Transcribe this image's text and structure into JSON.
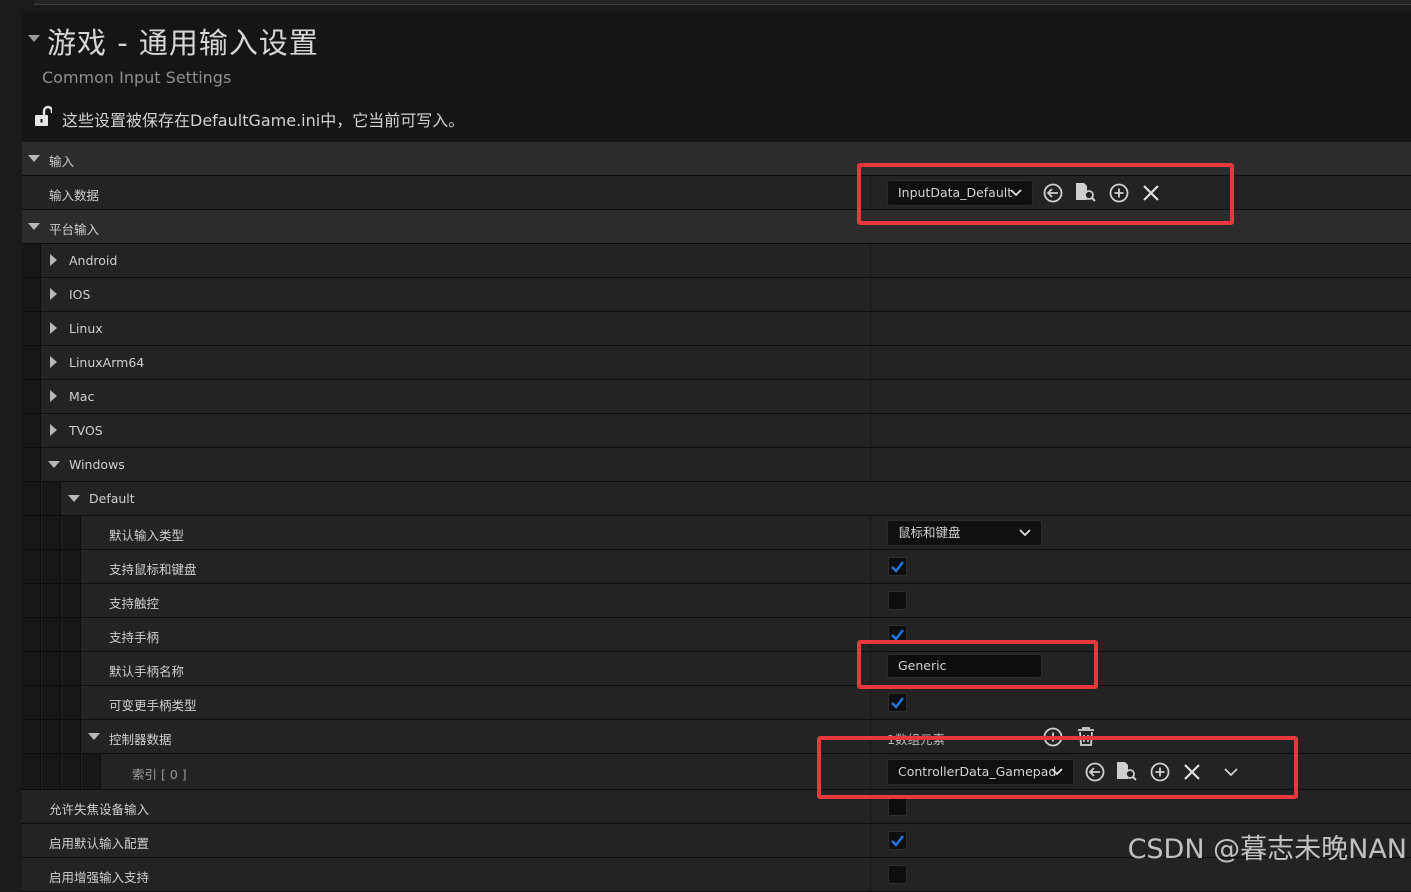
{
  "header": {
    "title": "游戏 - 通用输入设置",
    "subtitle": "Common Input Settings",
    "notice": "这些设置被保存在DefaultGame.ini中，它当前可写入。"
  },
  "sections": {
    "input": "输入",
    "input_data": "输入数据",
    "input_data_value": "InputData_Default",
    "platform_input": "平台输入",
    "platforms": [
      "Android",
      "IOS",
      "Linux",
      "LinuxArm64",
      "Mac",
      "TVOS",
      "Windows"
    ],
    "default": "Default",
    "default_input_type": "默认输入类型",
    "default_input_type_value": "鼠标和键盘",
    "support_mouse_keyboard": "支持鼠标和键盘",
    "support_mouse_keyboard_checked": true,
    "support_touch": "支持触控",
    "support_touch_checked": false,
    "support_gamepad": "支持手柄",
    "support_gamepad_checked": true,
    "default_gamepad_name": "默认手柄名称",
    "default_gamepad_name_value": "Generic",
    "can_change_gamepad_type": "可变更手柄类型",
    "can_change_gamepad_type_checked": true,
    "controller_data": "控制器数据",
    "controller_data_count": "1数组元素",
    "index_label": "索引 [ 0 ]",
    "index_value": "ControllerData_Gamepad",
    "allow_out_of_focus": "允许失焦设备输入",
    "allow_out_of_focus_checked": false,
    "enable_default_input_config": "启用默认输入配置",
    "enable_default_input_config_checked": true,
    "enable_enhanced_input": "启用增强输入支持",
    "enable_enhanced_input_checked": false
  },
  "watermark": "CSDN @暮志未晚NAN",
  "colors": {
    "accent_check": "#1f7ae6",
    "annotation": "#e8383d"
  }
}
